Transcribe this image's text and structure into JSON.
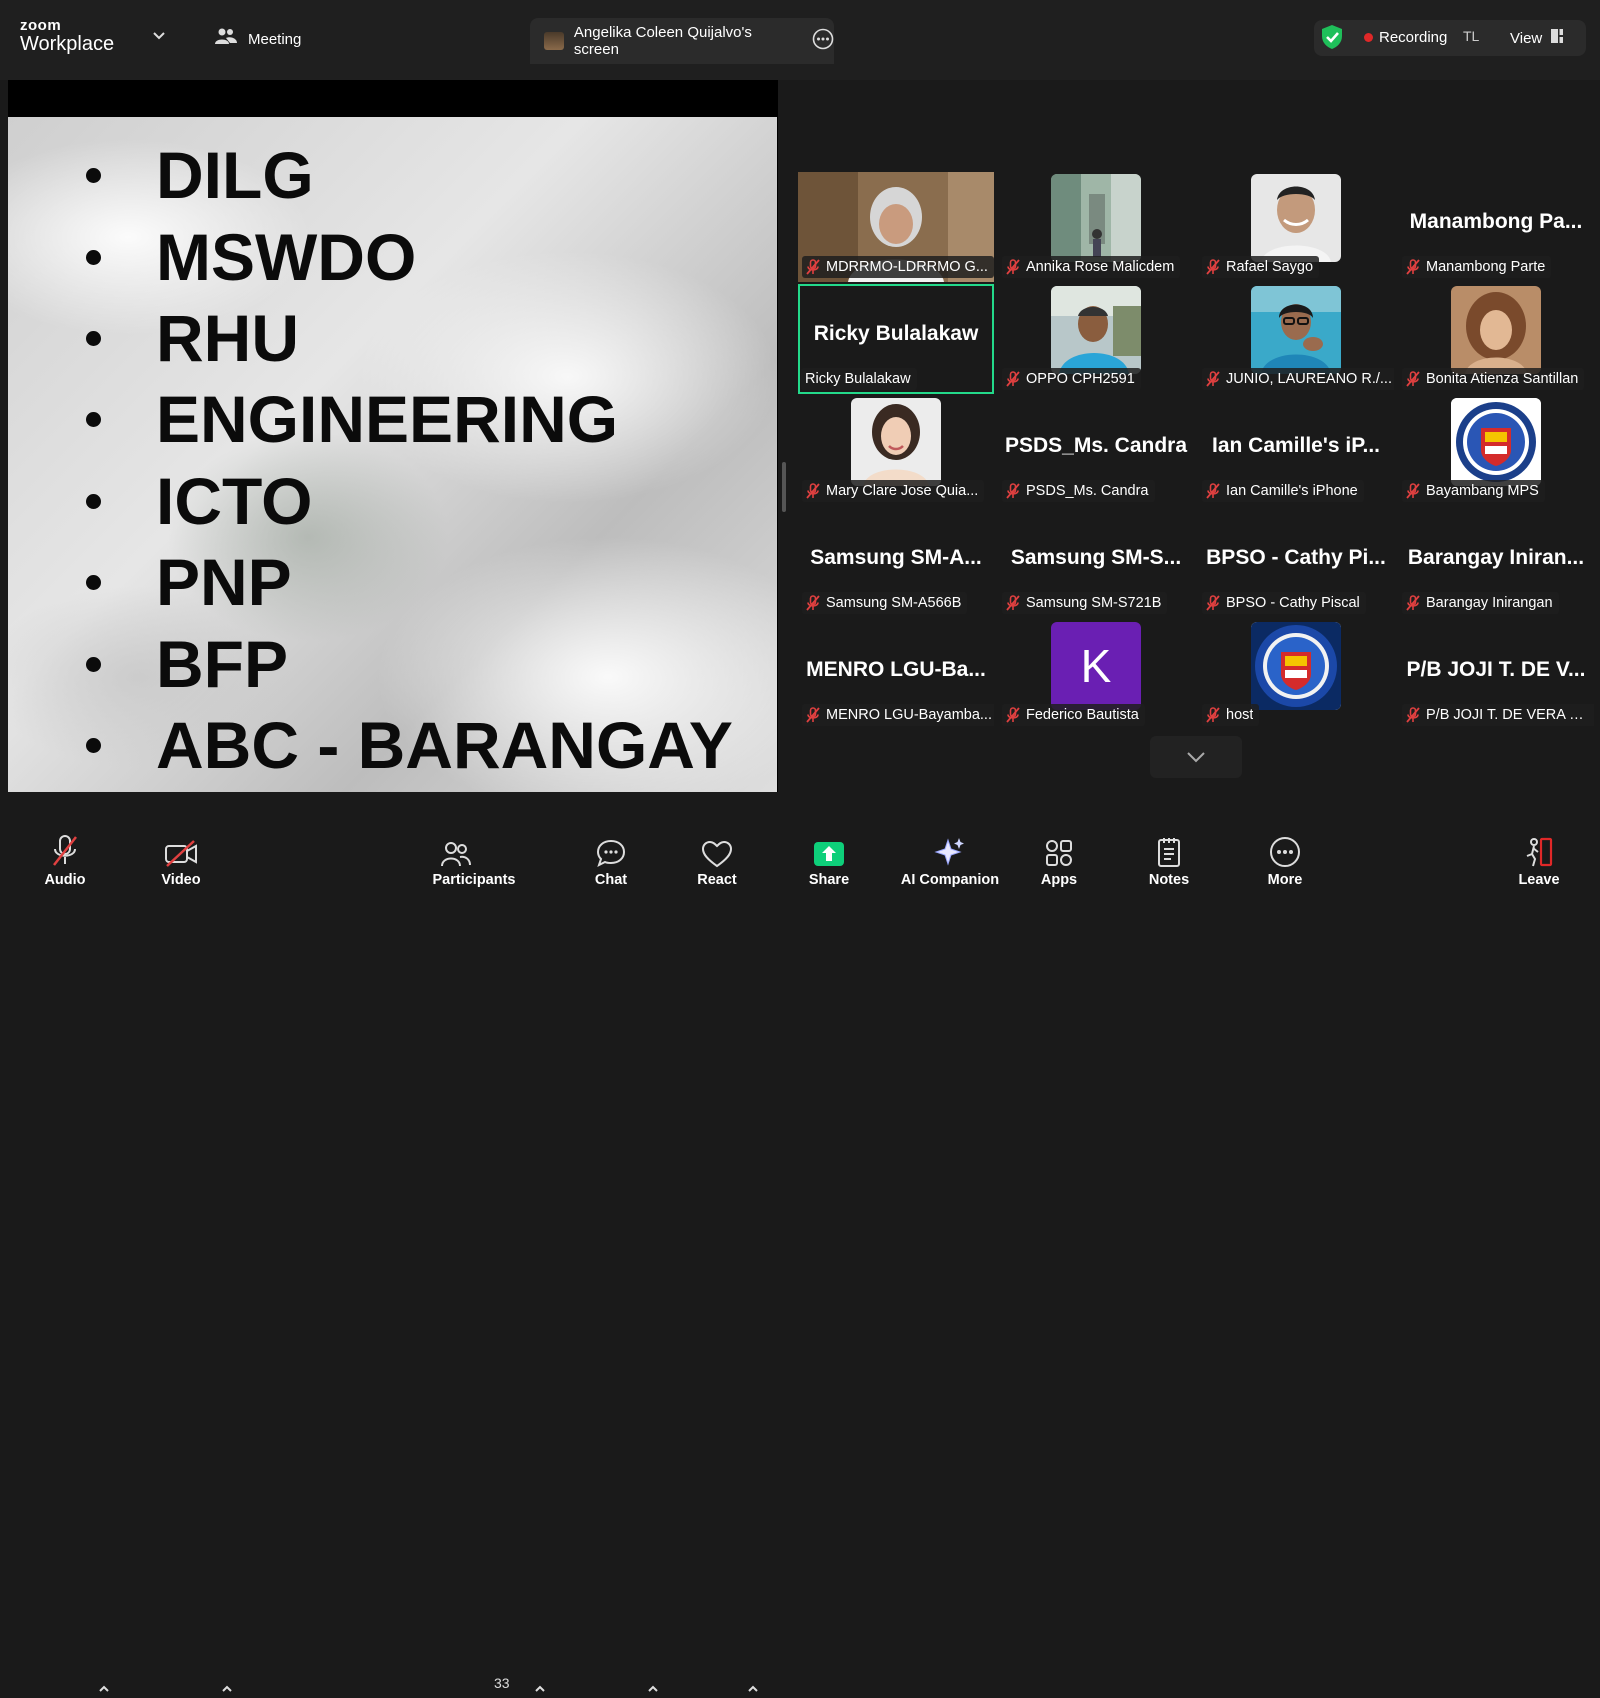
{
  "app": {
    "logo_top": "zoom",
    "logo_bottom": "Workplace"
  },
  "header": {
    "meeting_label": "Meeting",
    "share_tab_title": "Angelika Coleen Quijalvo's screen",
    "recording_label": "Recording",
    "user_initials": "TL",
    "view_label": "View"
  },
  "slide": {
    "items": [
      "DILG",
      "MSWDO",
      "RHU",
      "ENGINEERING",
      "ICTO",
      "PNP",
      "BFP",
      "ABC - BARANGAY"
    ]
  },
  "participants": [
    {
      "center": "",
      "label": "MDRRMO-LDRRMO G...",
      "video": "woman-grey"
    },
    {
      "center": "",
      "label": "Annika Rose Malicdem",
      "video": "street"
    },
    {
      "center": "",
      "label": "Rafael Saygo",
      "video": "man-portrait"
    },
    {
      "center": "Manambong  Pa...",
      "label": "Manambong Parte",
      "video": ""
    },
    {
      "center": "Ricky Bulalakaw",
      "label": "Ricky Bulalakaw",
      "video": "",
      "speaking": true
    },
    {
      "center": "",
      "label": "OPPO CPH2591",
      "video": "man-outdoor"
    },
    {
      "center": "",
      "label": "JUNIO, LAUREANO R./...",
      "video": "woman-blue"
    },
    {
      "center": "",
      "label": "Bonita Atienza Santillan",
      "video": "vintage"
    },
    {
      "center": "",
      "label": "Mary Clare Jose Quia...",
      "video": "woman-portrait"
    },
    {
      "center": "PSDS_Ms. Candra",
      "label": "PSDS_Ms. Candra",
      "video": ""
    },
    {
      "center": "Ian Camille's iP...",
      "label": "Ian Camille's iPhone",
      "video": ""
    },
    {
      "center": "",
      "label": "Bayambang MPS",
      "video": "seal"
    },
    {
      "center": "Samsung  SM-A...",
      "label": "Samsung SM-A566B",
      "video": ""
    },
    {
      "center": "Samsung  SM-S...",
      "label": "Samsung SM-S721B",
      "video": ""
    },
    {
      "center": "BPSO - Cathy Pi...",
      "label": "BPSO - Cathy Piscal",
      "video": ""
    },
    {
      "center": "Barangay  Iniran...",
      "label": "Barangay Inirangan",
      "video": ""
    },
    {
      "center": "MENRO  LGU-Ba...",
      "label": "MENRO LGU-Bayamba...",
      "video": ""
    },
    {
      "center": "",
      "label": "Federico Bautista",
      "video": "avatar-k",
      "avatar_letter": "K"
    },
    {
      "center": "",
      "label": "host",
      "video": "seal-blue"
    },
    {
      "center": "P/B JOJI  T. DE V...",
      "label": "P/B JOJI T. DE VERA & ...",
      "video": ""
    }
  ],
  "toolbar": {
    "audio": "Audio",
    "video": "Video",
    "participants": "Participants",
    "participants_count": "33",
    "chat": "Chat",
    "react": "React",
    "share": "Share",
    "ai": "AI Companion",
    "apps": "Apps",
    "notes": "Notes",
    "more": "More",
    "leave": "Leave"
  },
  "colors": {
    "speaking": "#23d98a",
    "share": "#0ecf7a",
    "recording": "#e02828",
    "muted": "#e04040",
    "leave": "#e02828"
  }
}
